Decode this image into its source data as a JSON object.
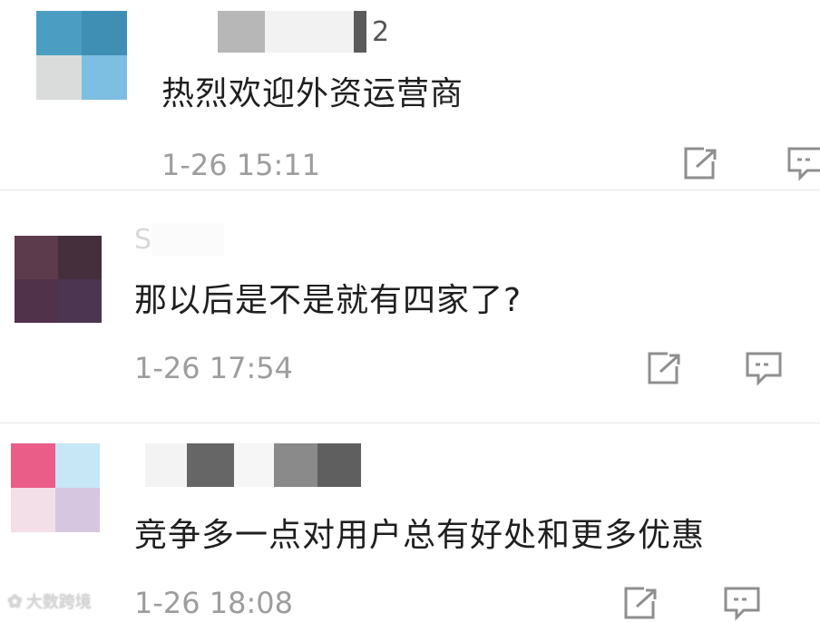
{
  "comments": [
    {
      "name_hint": "2",
      "text": "热烈欢迎外资运营商",
      "time": "1-26 15:11"
    },
    {
      "name_hint": "S",
      "text": "那以后是不是就有四家了?",
      "time": "1-26 17:54"
    },
    {
      "name_hint": "",
      "text": "竞争多一点对用户总有好处和更多优惠",
      "time": "1-26 18:08"
    }
  ],
  "watermark": "大数跨境",
  "colors": {
    "text": "#1f1f1f",
    "meta": "#9d9d9d",
    "icon": "#8f8f8f",
    "divider": "#e6e6e6"
  },
  "icons": [
    "share-icon",
    "reply-icon"
  ]
}
